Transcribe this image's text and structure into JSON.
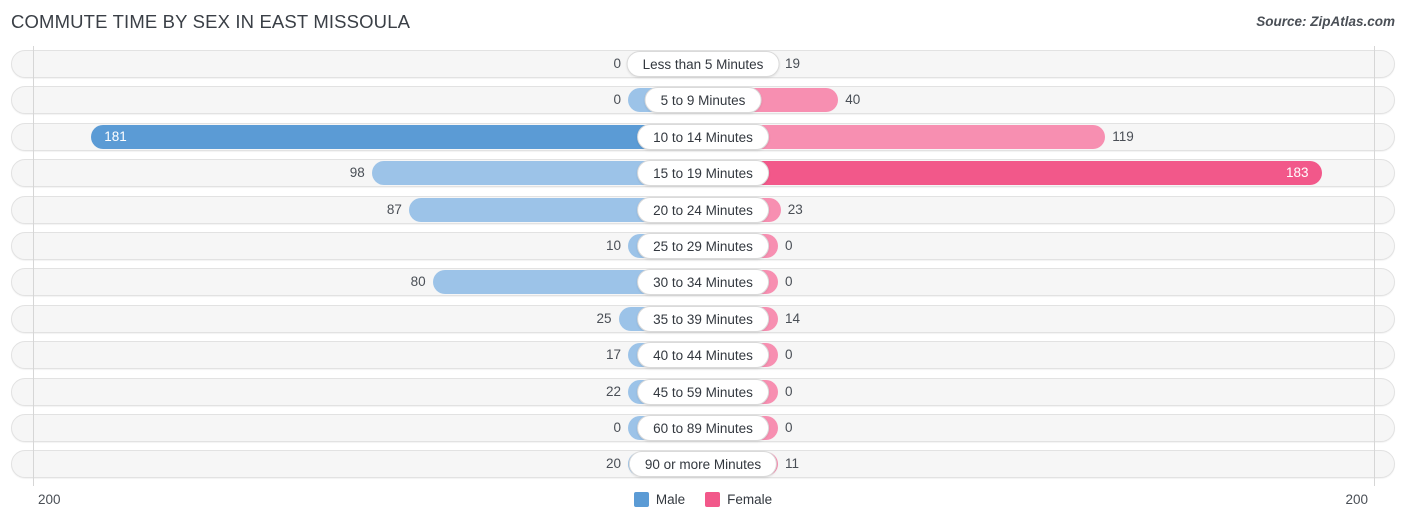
{
  "header": {
    "title": "COMMUTE TIME BY SEX IN EAST MISSOULA",
    "source": "Source: ZipAtlas.com"
  },
  "legend": {
    "items": [
      {
        "label": "Male",
        "color": "#5b9bd5"
      },
      {
        "label": "Female",
        "color": "#f2588a"
      }
    ]
  },
  "axis": {
    "left_tick": "200",
    "right_tick": "200",
    "max": 200
  },
  "colors": {
    "male_light": "#9cc3e8",
    "male_dark": "#5b9bd5",
    "female_light": "#f78fb1",
    "female_dark": "#f2588a",
    "track": "#f6f6f6",
    "track_border": "#e2e2e2"
  },
  "chart_data": {
    "type": "bar",
    "title": "COMMUTE TIME BY SEX IN EAST MISSOULA",
    "subtitle": "Source: ZipAtlas.com",
    "orientation": "horizontal-diverging",
    "xlabel": "",
    "ylabel": "",
    "xlim": [
      -200,
      200
    ],
    "axis_tick_labels": [
      "200",
      "200"
    ],
    "grid": false,
    "legend_position": "bottom-center",
    "categories": [
      "Less than 5 Minutes",
      "5 to 9 Minutes",
      "10 to 14 Minutes",
      "15 to 19 Minutes",
      "20 to 24 Minutes",
      "25 to 29 Minutes",
      "30 to 34 Minutes",
      "35 to 39 Minutes",
      "40 to 44 Minutes",
      "45 to 59 Minutes",
      "60 to 89 Minutes",
      "90 or more Minutes"
    ],
    "series": [
      {
        "name": "Male",
        "values": [
          0,
          0,
          181,
          98,
          87,
          10,
          80,
          25,
          17,
          22,
          0,
          20
        ]
      },
      {
        "name": "Female",
        "values": [
          19,
          40,
          119,
          183,
          23,
          0,
          0,
          14,
          0,
          0,
          0,
          11
        ]
      }
    ]
  },
  "rows": [
    {
      "category": "Less than 5 Minutes",
      "male": "0",
      "female": "19",
      "male_value": 0,
      "female_value": 19
    },
    {
      "category": "5 to 9 Minutes",
      "male": "0",
      "female": "40",
      "male_value": 0,
      "female_value": 40
    },
    {
      "category": "10 to 14 Minutes",
      "male": "181",
      "female": "119",
      "male_value": 181,
      "female_value": 119
    },
    {
      "category": "15 to 19 Minutes",
      "male": "98",
      "female": "183",
      "male_value": 98,
      "female_value": 183
    },
    {
      "category": "20 to 24 Minutes",
      "male": "87",
      "female": "23",
      "male_value": 87,
      "female_value": 23
    },
    {
      "category": "25 to 29 Minutes",
      "male": "10",
      "female": "0",
      "male_value": 10,
      "female_value": 0
    },
    {
      "category": "30 to 34 Minutes",
      "male": "80",
      "female": "0",
      "male_value": 80,
      "female_value": 0
    },
    {
      "category": "35 to 39 Minutes",
      "male": "25",
      "female": "14",
      "male_value": 25,
      "female_value": 14
    },
    {
      "category": "40 to 44 Minutes",
      "male": "17",
      "female": "0",
      "male_value": 17,
      "female_value": 0
    },
    {
      "category": "45 to 59 Minutes",
      "male": "22",
      "female": "0",
      "male_value": 22,
      "female_value": 0
    },
    {
      "category": "60 to 89 Minutes",
      "male": "0",
      "female": "0",
      "male_value": 0,
      "female_value": 0
    },
    {
      "category": "90 or more Minutes",
      "male": "20",
      "female": "11",
      "male_value": 20,
      "female_value": 11
    }
  ]
}
